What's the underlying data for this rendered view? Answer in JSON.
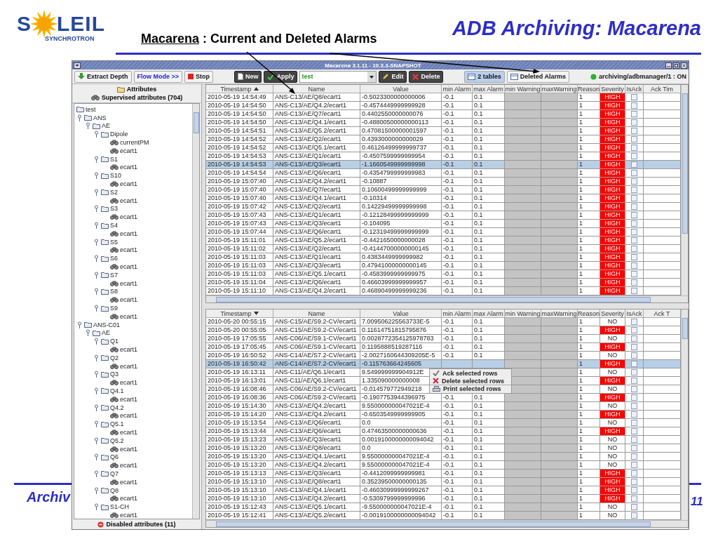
{
  "slide": {
    "logo": {
      "name_start": "S",
      "name_end": "LEIL",
      "tagline": "SYNCHROTRON"
    },
    "title": "ADB Archiving: Macarena",
    "subtitle_link": "Macarena",
    "subtitle": " : Current and Deleted Alarms",
    "footer": "Archiv",
    "page": "11"
  },
  "window": {
    "title": "Macarena 3.1.11 - 10.3.3-SNAPSHOT"
  },
  "toolbar": [
    {
      "items": [
        {
          "kind": "extract",
          "label": "Extract Depth"
        },
        {
          "kind": "flow",
          "label": "Flow Mode >>"
        },
        {
          "kind": "stop",
          "label": "Stop"
        }
      ]
    },
    {
      "items": [
        {
          "kind": "new",
          "label": "New"
        },
        {
          "kind": "apply",
          "label": "Apply"
        },
        {
          "kind": "combo",
          "label": "test"
        },
        {
          "kind": "edit",
          "label": "Edit"
        },
        {
          "kind": "delete",
          "label": "Delete"
        }
      ]
    },
    {
      "items": [
        {
          "kind": "tables",
          "label": "2 tables",
          "selected": true
        },
        {
          "kind": "deleted",
          "label": "Deleted Alarms",
          "selected": false
        }
      ]
    },
    {
      "items": [
        {
          "kind": "status",
          "label": "archiving/adbmanager/1 : ON",
          "on": true
        }
      ]
    }
  ],
  "sidebar": {
    "title": "Attributes",
    "subtitle": "Supervised attributes (704)",
    "footer": "Disabled attributes (11)",
    "tree": [
      {
        "label": "test",
        "kind": "folder",
        "children": [
          {
            "label": "ANS",
            "kind": "folder",
            "expanded": true,
            "children": [
              {
                "label": "AE",
                "kind": "folder",
                "expanded": true,
                "children": [
                  {
                    "label": "Dipole",
                    "kind": "folder",
                    "expanded": true,
                    "children": [
                      {
                        "label": "currentPM",
                        "kind": "attribute"
                      },
                      {
                        "label": "ecart1",
                        "kind": "attribute"
                      }
                    ]
                  },
                  {
                    "label": "S1",
                    "kind": "folder",
                    "expanded": true,
                    "children": [
                      {
                        "label": "ecart1",
                        "kind": "attribute"
                      }
                    ]
                  },
                  {
                    "label": "S10",
                    "kind": "folder",
                    "expanded": true,
                    "children": [
                      {
                        "label": "ecart1",
                        "kind": "attribute"
                      }
                    ]
                  },
                  {
                    "label": "S2",
                    "kind": "folder",
                    "expanded": true,
                    "children": [
                      {
                        "label": "ecart1",
                        "kind": "attribute"
                      }
                    ]
                  },
                  {
                    "label": "S3",
                    "kind": "folder",
                    "expanded": true,
                    "children": [
                      {
                        "label": "ecart1",
                        "kind": "attribute"
                      }
                    ]
                  },
                  {
                    "label": "S4",
                    "kind": "folder",
                    "expanded": true,
                    "children": [
                      {
                        "label": "ecart1",
                        "kind": "attribute"
                      }
                    ]
                  },
                  {
                    "label": "S5",
                    "kind": "folder",
                    "expanded": true,
                    "children": [
                      {
                        "label": "ecart1",
                        "kind": "attribute"
                      }
                    ]
                  },
                  {
                    "label": "S6",
                    "kind": "folder",
                    "expanded": true,
                    "children": [
                      {
                        "label": "ecart1",
                        "kind": "attribute"
                      }
                    ]
                  },
                  {
                    "label": "S7",
                    "kind": "folder",
                    "expanded": true,
                    "children": [
                      {
                        "label": "ecart1",
                        "kind": "attribute"
                      }
                    ]
                  },
                  {
                    "label": "S8",
                    "kind": "folder",
                    "expanded": true,
                    "children": [
                      {
                        "label": "ecart1",
                        "kind": "attribute"
                      }
                    ]
                  },
                  {
                    "label": "S9",
                    "kind": "folder",
                    "expanded": true,
                    "children": [
                      {
                        "label": "ecart1",
                        "kind": "attribute"
                      }
                    ]
                  }
                ]
              }
            ]
          },
          {
            "label": "ANS-C01",
            "kind": "folder",
            "expanded": true,
            "children": [
              {
                "label": "AE",
                "kind": "folder",
                "expanded": true,
                "children": [
                  {
                    "label": "Q1",
                    "kind": "folder",
                    "expanded": true,
                    "children": [
                      {
                        "label": "ecart1",
                        "kind": "attribute"
                      }
                    ]
                  },
                  {
                    "label": "Q2",
                    "kind": "folder",
                    "expanded": true,
                    "children": [
                      {
                        "label": "ecart1",
                        "kind": "attribute"
                      }
                    ]
                  },
                  {
                    "label": "Q3",
                    "kind": "folder",
                    "expanded": true,
                    "children": [
                      {
                        "label": "ecart1",
                        "kind": "attribute"
                      }
                    ]
                  },
                  {
                    "label": "Q4.1",
                    "kind": "folder",
                    "expanded": true,
                    "children": [
                      {
                        "label": "ecart1",
                        "kind": "attribute"
                      }
                    ]
                  },
                  {
                    "label": "Q4.2",
                    "kind": "folder",
                    "expanded": true,
                    "children": [
                      {
                        "label": "ecart1",
                        "kind": "attribute"
                      }
                    ]
                  },
                  {
                    "label": "Q5.1",
                    "kind": "folder",
                    "expanded": true,
                    "children": [
                      {
                        "label": "ecart1",
                        "kind": "attribute"
                      }
                    ]
                  },
                  {
                    "label": "Q5.2",
                    "kind": "folder",
                    "expanded": true,
                    "children": [
                      {
                        "label": "ecart1",
                        "kind": "attribute"
                      }
                    ]
                  },
                  {
                    "label": "Q6",
                    "kind": "folder",
                    "expanded": true,
                    "children": [
                      {
                        "label": "ecart1",
                        "kind": "attribute"
                      }
                    ]
                  },
                  {
                    "label": "Q7",
                    "kind": "folder",
                    "expanded": true,
                    "children": [
                      {
                        "label": "ecart1",
                        "kind": "attribute"
                      }
                    ]
                  },
                  {
                    "label": "Q8",
                    "kind": "folder",
                    "expanded": true,
                    "children": [
                      {
                        "label": "ecart1",
                        "kind": "attribute"
                      }
                    ]
                  },
                  {
                    "label": "S1-CH",
                    "kind": "folder",
                    "expanded": true,
                    "children": [
                      {
                        "label": "ecart1",
                        "kind": "attribute"
                      }
                    ]
                  }
                ]
              }
            ]
          }
        ]
      }
    ]
  },
  "current_table": {
    "columns": [
      {
        "label": "Timestamp",
        "sorted": true,
        "descending": false
      },
      {
        "label": "Name"
      },
      {
        "label": "Value"
      },
      {
        "label": "min Alarm"
      },
      {
        "label": "max Alarm"
      },
      {
        "label": "min Warning"
      },
      {
        "label": "maxWarning"
      },
      {
        "label": "Reason"
      },
      {
        "label": "Severity"
      },
      {
        "label": "IsAck"
      },
      {
        "label": "Ack Tim"
      }
    ],
    "rows": [
      {
        "timestamp": "2010-05-19 14:54:49",
        "name": "ANS-C13/AE/Q8/ecart1",
        "value": "-0.5023300000000006",
        "min_alarm": "-0.1",
        "max_alarm": "0.1",
        "reason": "1",
        "severity": "HIGH",
        "color": "#ff0000",
        "is_ack": false,
        "selected": false
      },
      {
        "timestamp": "2010-05-19 14:54:50",
        "name": "ANS-C13/AE/Q4.2/ecart1",
        "value": "-0.4574449999999928",
        "min_alarm": "-0.1",
        "max_alarm": "0.1",
        "reason": "1",
        "severity": "HIGH",
        "color": "#ff0000",
        "is_ack": false,
        "selected": false
      },
      {
        "timestamp": "2010-05-19 14:54:50",
        "name": "ANS-C13/AE/Q7/ecart1",
        "value": "0.4402550000000076",
        "min_alarm": "-0.1",
        "max_alarm": "0.1",
        "reason": "1",
        "severity": "HIGH",
        "color": "#ff0000",
        "is_ack": false,
        "selected": false
      },
      {
        "timestamp": "2010-05-19 14:54:50",
        "name": "ANS-C13/AE/Q4.1/ecart1",
        "value": "-0.48800500000000113",
        "min_alarm": "-0.1",
        "max_alarm": "0.1",
        "reason": "1",
        "severity": "HIGH",
        "color": "#ff0000",
        "is_ack": false,
        "selected": false
      },
      {
        "timestamp": "2010-05-19 14:54:51",
        "name": "ANS-C13/AE/Q5.2/ecart1",
        "value": "0.47081500000001597",
        "min_alarm": "-0.1",
        "max_alarm": "0.1",
        "reason": "1",
        "severity": "HIGH",
        "color": "#ff0000",
        "is_ack": false,
        "selected": false
      },
      {
        "timestamp": "2010-05-19 14:54:52",
        "name": "ANS-C13/AE/Q2/ecart1",
        "value": "0.4393000000000029",
        "min_alarm": "-0.1",
        "max_alarm": "0.1",
        "reason": "1",
        "severity": "HIGH",
        "color": "#ff0000",
        "is_ack": false,
        "selected": false
      },
      {
        "timestamp": "2010-05-19 14:54:52",
        "name": "ANS-C13/AE/Q5.1/ecart1",
        "value": "0.46126499999999737",
        "min_alarm": "-0.1",
        "max_alarm": "0.1",
        "reason": "1",
        "severity": "HIGH",
        "color": "#ff0000",
        "is_ack": false,
        "selected": false
      },
      {
        "timestamp": "2010-05-19 14:54:53",
        "name": "ANS-C13/AE/Q1/ecart1",
        "value": "-0.4507599999999954",
        "min_alarm": "-0.1",
        "max_alarm": "0.1",
        "reason": "1",
        "severity": "HIGH",
        "color": "#ff0000",
        "is_ack": false,
        "selected": false
      },
      {
        "timestamp": "2010-05-19 14:54:53",
        "name": "ANS-C13/AE/Q3/ecart1",
        "value": "-1.1660549999999998",
        "min_alarm": "-0.1",
        "max_alarm": "0.1",
        "reason": "1",
        "severity": "HIGH",
        "color": "#ff0000",
        "is_ack": false,
        "selected": true
      },
      {
        "timestamp": "2010-05-19 14:54:54",
        "name": "ANS-C13/AE/Q6/ecart1",
        "value": "-0.4354799999999983",
        "min_alarm": "-0.1",
        "max_alarm": "0.1",
        "reason": "1",
        "severity": "HIGH",
        "color": "#ff0000",
        "is_ack": false,
        "selected": false
      },
      {
        "timestamp": "2010-05-19 15:07:40",
        "name": "ANS-C13/AE/Q4.2/ecart1",
        "value": "-0.10887",
        "min_alarm": "-0.1",
        "max_alarm": "0.1",
        "reason": "1",
        "severity": "HIGH",
        "color": "#ff0000",
        "is_ack": false,
        "selected": false
      },
      {
        "timestamp": "2010-05-19 15:07:40",
        "name": "ANS-C13/AE/Q7/ecart1",
        "value": "0.10600499999999999",
        "min_alarm": "-0.1",
        "max_alarm": "0.1",
        "reason": "1",
        "severity": "HIGH",
        "color": "#ff0000",
        "is_ack": false,
        "selected": false
      },
      {
        "timestamp": "2010-05-19 15:07:40",
        "name": "ANS-C13/AE/Q4.1/ecart1",
        "value": "-0.10314",
        "min_alarm": "-0.1",
        "max_alarm": "0.1",
        "reason": "1",
        "severity": "HIGH",
        "color": "#ff0000",
        "is_ack": false,
        "selected": false
      },
      {
        "timestamp": "2010-05-19 15:07:42",
        "name": "ANS-C13/AE/Q2/ecart1",
        "value": "0.14229499999999998",
        "min_alarm": "-0.1",
        "max_alarm": "0.1",
        "reason": "1",
        "severity": "HIGH",
        "color": "#ff0000",
        "is_ack": false,
        "selected": false
      },
      {
        "timestamp": "2010-05-19 15:07:43",
        "name": "ANS-C13/AE/Q1/ecart1",
        "value": "-0.12128499999999999",
        "min_alarm": "-0.1",
        "max_alarm": "0.1",
        "reason": "1",
        "severity": "HIGH",
        "color": "#ff0000",
        "is_ack": false,
        "selected": false
      },
      {
        "timestamp": "2010-05-19 15:07:43",
        "name": "ANS-C13/AE/Q3/ecart1",
        "value": "-0.104095",
        "min_alarm": "-0.1",
        "max_alarm": "0.1",
        "reason": "1",
        "severity": "HIGH",
        "color": "#ff0000",
        "is_ack": false,
        "selected": false
      },
      {
        "timestamp": "2010-05-19 15:07:44",
        "name": "ANS-C13/AE/Q6/ecart1",
        "value": "-0.12319499999999999",
        "min_alarm": "-0.1",
        "max_alarm": "0.1",
        "reason": "1",
        "severity": "HIGH",
        "color": "#ff0000",
        "is_ack": false,
        "selected": false
      },
      {
        "timestamp": "2010-05-19 15:11:01",
        "name": "ANS-C13/AE/Q5.2/ecart1",
        "value": "-0.4421650000000028",
        "min_alarm": "-0.1",
        "max_alarm": "0.1",
        "reason": "1",
        "severity": "HIGH",
        "color": "#ff0000",
        "is_ack": false,
        "selected": false
      },
      {
        "timestamp": "2010-05-19 15:11:02",
        "name": "ANS-C13/AE/Q2/ecart1",
        "value": "-0.41447000000000145",
        "min_alarm": "-0.1",
        "max_alarm": "0.1",
        "reason": "1",
        "severity": "HIGH",
        "color": "#ff0000",
        "is_ack": false,
        "selected": false
      },
      {
        "timestamp": "2010-05-19 15:11:03",
        "name": "ANS-C13/AE/Q1/ecart1",
        "value": "0.4383449999999982",
        "min_alarm": "-0.1",
        "max_alarm": "0.1",
        "reason": "1",
        "severity": "HIGH",
        "color": "#ff0000",
        "is_ack": false,
        "selected": false
      },
      {
        "timestamp": "2010-05-19 15:11:03",
        "name": "ANS-C13/AE/Q3/ecart1",
        "value": "0.47941000000000145",
        "min_alarm": "-0.1",
        "max_alarm": "0.1",
        "reason": "1",
        "severity": "HIGH",
        "color": "#ff0000",
        "is_ack": false,
        "selected": false
      },
      {
        "timestamp": "2010-05-19 15:11:03",
        "name": "ANS-C13/AE/Q5.1/ecart1",
        "value": "-0.4583999999999975",
        "min_alarm": "-0.1",
        "max_alarm": "0.1",
        "reason": "1",
        "severity": "HIGH",
        "color": "#ff0000",
        "is_ack": false,
        "selected": false
      },
      {
        "timestamp": "2010-05-19 15:11:04",
        "name": "ANS-C13/AE/Q6/ecart1",
        "value": "0.46603999999999957",
        "min_alarm": "-0.1",
        "max_alarm": "0.1",
        "reason": "1",
        "severity": "HIGH",
        "color": "#ff0000",
        "is_ack": false,
        "selected": false
      },
      {
        "timestamp": "2010-05-19 15:11:10",
        "name": "ANS-C13/AE/Q4.2/ecart1",
        "value": "0.46890499999999236",
        "min_alarm": "-0.1",
        "max_alarm": "0.1",
        "reason": "1",
        "severity": "HIGH",
        "color": "#ff0000",
        "is_ack": false,
        "selected": false
      }
    ]
  },
  "deleted_table": {
    "columns": [
      {
        "label": "Timestamp",
        "sorted": true,
        "descending": true
      },
      {
        "label": "Name"
      },
      {
        "label": "Value"
      },
      {
        "label": "min Alarm"
      },
      {
        "label": "max Alarm"
      },
      {
        "label": "min Warning"
      },
      {
        "label": "maxWarning"
      },
      {
        "label": "Reason"
      },
      {
        "label": "Severity"
      },
      {
        "label": "IsAck"
      },
      {
        "label": "Ack T"
      }
    ],
    "rows": [
      {
        "timestamp": "2010-05-20 00:55:15",
        "name": "ANS-C15/AE/S9.2-CV/ecart1",
        "value": "7.009506225563733E-5",
        "min_alarm": "-0.1",
        "max_alarm": "0.1",
        "reason": "1",
        "severity": "NO",
        "color": "#ffffff",
        "is_ack": false,
        "selected": false
      },
      {
        "timestamp": "2010-05-20 00:55:05",
        "name": "ANS-C15/AE/S9.2-CV/ecart1",
        "value": "0.11614751815795876",
        "min_alarm": "-0.1",
        "max_alarm": "0.1",
        "reason": "1",
        "severity": "HIGH",
        "color": "#ff0000",
        "is_ack": false,
        "selected": false
      },
      {
        "timestamp": "2010-05-19 17:05:55",
        "name": "ANS-C06/AE/S9.1-CV/ecart1",
        "value": "0.0028772354125978783",
        "min_alarm": "-0.1",
        "max_alarm": "0.1",
        "reason": "1",
        "severity": "NO",
        "color": "#ffffff",
        "is_ack": false,
        "selected": false
      },
      {
        "timestamp": "2010-05-19 17:05:45",
        "name": "ANS-C06/AE/S9.1-CV/ecart1",
        "value": "0.1195888519287116",
        "min_alarm": "-0.1",
        "max_alarm": "0.1",
        "reason": "1",
        "severity": "HIGH",
        "color": "#ff0000",
        "is_ack": false,
        "selected": false
      },
      {
        "timestamp": "2010-05-19 16:50:52",
        "name": "ANS-C14/AE/S7.2-CV/ecart1",
        "value": "-2.0027160644309205E-5",
        "min_alarm": "-0.1",
        "max_alarm": "0.1",
        "reason": "1",
        "severity": "NO",
        "color": "#ffffff",
        "is_ack": false,
        "selected": false
      },
      {
        "timestamp": "2010-05-19 16:50:42",
        "name": "ANS-C14/AE/S7.2-CV/ecart1",
        "value": "-0.115763664245605",
        "reason": "1",
        "severity": "HIGH",
        "color": "#ff0000",
        "is_ack": false,
        "selected": true
      },
      {
        "timestamp": "2010-05-19 16:13:11",
        "name": "ANS-C11/AE/Q6.1/ecart1",
        "value": "9.549999999904912E",
        "reason": "1",
        "severity": "NO",
        "color": "#ffffff",
        "is_ack": false,
        "selected": false
      },
      {
        "timestamp": "2010-05-19 16:13:01",
        "name": "ANS-C11/AE/Q6.1/ecart1",
        "value": "1.335090000000008",
        "reason": "1",
        "severity": "HIGH",
        "color": "#ff0000",
        "is_ack": false,
        "selected": false
      },
      {
        "timestamp": "2010-05-19 16:08:46",
        "name": "ANS-C06/AE/S9.2-CV/ecart1",
        "value": "-0.014579772949218",
        "reason": "1",
        "severity": "NO",
        "color": "#ffffff",
        "is_ack": false,
        "selected": false
      },
      {
        "timestamp": "2010-05-19 16:08:36",
        "name": "ANS-C06/AE/S9.2-CV/ecart1",
        "value": "-0.1907753944396975",
        "min_alarm": "-0.1",
        "max_alarm": "0.1",
        "reason": "1",
        "severity": "HIGH",
        "color": "#ff0000",
        "is_ack": false,
        "selected": false
      },
      {
        "timestamp": "2010-05-19 15:14:30",
        "name": "ANS-C13/AE/Q4.2/ecart1",
        "value": "9.550000000047021E-4",
        "min_alarm": "-0.1",
        "max_alarm": "0.1",
        "reason": "1",
        "severity": "NO",
        "color": "#ffffff",
        "is_ack": false,
        "selected": false
      },
      {
        "timestamp": "2010-05-19 15:14:20",
        "name": "ANS-C13/AE/Q4.2/ecart1",
        "value": "-0.6503549999999905",
        "min_alarm": "-0.1",
        "max_alarm": "0.1",
        "reason": "1",
        "severity": "HIGH",
        "color": "#ff0000",
        "is_ack": false,
        "selected": false
      },
      {
        "timestamp": "2010-05-19 15:13:54",
        "name": "ANS-C13/AE/Q6/ecart1",
        "value": "0.0",
        "min_alarm": "-0.1",
        "max_alarm": "0.1",
        "reason": "1",
        "severity": "NO",
        "color": "#ffffff",
        "is_ack": false,
        "selected": false
      },
      {
        "timestamp": "2010-05-19 15:13:44",
        "name": "ANS-C13/AE/Q6/ecart1",
        "value": "0.47463500000000636",
        "min_alarm": "-0.1",
        "max_alarm": "0.1",
        "reason": "1",
        "severity": "HIGH",
        "color": "#ff0000",
        "is_ack": false,
        "selected": false
      },
      {
        "timestamp": "2010-05-19 15:13:23",
        "name": "ANS-C13/AE/Q3/ecart1",
        "value": "0.0019100000000094042",
        "min_alarm": "-0.1",
        "max_alarm": "0.1",
        "reason": "1",
        "severity": "NO",
        "color": "#ffffff",
        "is_ack": false,
        "selected": false
      },
      {
        "timestamp": "2010-05-19 15:13:20",
        "name": "ANS-C13/AE/Q8/ecart1",
        "value": "0.0",
        "min_alarm": "-0.1",
        "max_alarm": "0.1",
        "reason": "1",
        "severity": "NO",
        "color": "#ffffff",
        "is_ack": false,
        "selected": false
      },
      {
        "timestamp": "2010-05-19 15:13:20",
        "name": "ANS-C13/AE/Q4.1/ecart1",
        "value": "9.550000000047021E-4",
        "min_alarm": "-0.1",
        "max_alarm": "0.1",
        "reason": "1",
        "severity": "NO",
        "color": "#ffffff",
        "is_ack": false,
        "selected": false
      },
      {
        "timestamp": "2010-05-19 15:13:20",
        "name": "ANS-C13/AE/Q4.2/ecart1",
        "value": "9.550000000047021E-4",
        "min_alarm": "-0.1",
        "max_alarm": "0.1",
        "reason": "1",
        "severity": "NO",
        "color": "#ffffff",
        "is_ack": false,
        "selected": false
      },
      {
        "timestamp": "2010-05-19 15:13:13",
        "name": "ANS-C13/AE/Q3/ecart1",
        "value": "-0.4412099999999981",
        "min_alarm": "-0.1",
        "max_alarm": "0.1",
        "reason": "1",
        "severity": "HIGH",
        "color": "#ff0000",
        "is_ack": false,
        "selected": false
      },
      {
        "timestamp": "2010-05-19 15:13:10",
        "name": "ANS-C13/AE/Q8/ecart1",
        "value": "0.35239500000000135",
        "min_alarm": "-0.1",
        "max_alarm": "0.1",
        "reason": "1",
        "severity": "HIGH",
        "color": "#ff0000",
        "is_ack": false,
        "selected": false
      },
      {
        "timestamp": "2010-05-19 15:13:10",
        "name": "ANS-C13/AE/Q4.1/ecart1",
        "value": "-0.46030999999999267",
        "min_alarm": "-0.1",
        "max_alarm": "0.1",
        "reason": "1",
        "severity": "HIGH",
        "color": "#ff0000",
        "is_ack": false,
        "selected": false
      },
      {
        "timestamp": "2010-05-19 15:13:10",
        "name": "ANS-C13/AE/Q4.2/ecart1",
        "value": "-0.5309799999999996",
        "min_alarm": "-0.1",
        "max_alarm": "0.1",
        "reason": "1",
        "severity": "HIGH",
        "color": "#ff0000",
        "is_ack": false,
        "selected": false
      },
      {
        "timestamp": "2010-05-19 15:12:43",
        "name": "ANS-C13/AE/Q5.1/ecart1",
        "value": "-9.550000000047021E-4",
        "min_alarm": "-0.1",
        "max_alarm": "0.1",
        "reason": "1",
        "severity": "NO",
        "color": "#ffffff",
        "is_ack": false,
        "selected": false
      },
      {
        "timestamp": "2010-05-19 15:12:41",
        "name": "ANS-C13/AE/Q5.2/ecart1",
        "value": "-0.0019100000000094042",
        "min_alarm": "-0.1",
        "max_alarm": "0.1",
        "reason": "1",
        "severity": "NO",
        "color": "#ffffff",
        "is_ack": false,
        "selected": false
      }
    ],
    "context_menu": [
      {
        "kind": "ack",
        "label": "Ack selected rows"
      },
      {
        "kind": "delete",
        "label": "Delete selected rows"
      },
      {
        "kind": "print",
        "label": "Print selected rows"
      }
    ]
  }
}
